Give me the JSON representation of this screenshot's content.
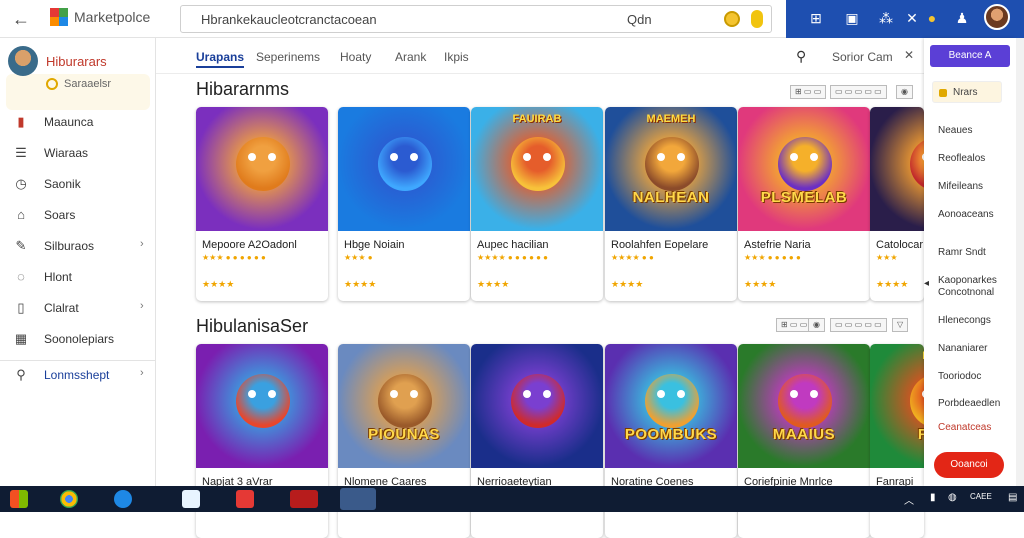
{
  "app": {
    "logo_text": "Marketpolce",
    "search_query": "Hbrankekaucleotcranctacoean",
    "search_hint": "Qdn"
  },
  "colors": {
    "accent": "#1a3f9a",
    "topbar_blue": "#1e4fb0",
    "primary_button": "#5b3fd6",
    "danger": "#e32616"
  },
  "sidebar": {
    "profile": {
      "name": "Hiburarars",
      "sub": "Saraaelsr"
    },
    "items": [
      {
        "label": "Maaunca",
        "icon": "home-icon",
        "chevron": ""
      },
      {
        "label": "Wiaraas",
        "icon": "list-icon",
        "chevron": ""
      },
      {
        "label": "Saonik",
        "icon": "clock-icon",
        "chevron": ""
      },
      {
        "label": "Soars",
        "icon": "bookmark-icon",
        "chevron": ""
      },
      {
        "label": "Silburaos",
        "icon": "tag-icon",
        "chevron": "›"
      },
      {
        "label": "Hlont",
        "icon": "chat-icon",
        "chevron": ""
      },
      {
        "label": "Clalrat",
        "icon": "document-icon",
        "chevron": "›"
      },
      {
        "label": "Soonolepiars",
        "icon": "grid-icon",
        "chevron": ""
      },
      {
        "label": "Lonmsshept",
        "icon": "search-icon",
        "chevron": "›"
      }
    ]
  },
  "tabs": {
    "items": [
      "Urapans",
      "Seperinems",
      "Hoaty",
      "Arank",
      "Ikpis"
    ],
    "sort_label": "Sorior Cam",
    "close_glyph": "✕"
  },
  "sections": [
    {
      "title": "Hibararnms",
      "controls": [
        "⊞ ▭ ▭",
        "▭ ▭ ▭ ▭ ▭",
        "◉"
      ],
      "cards": [
        {
          "title": "Mepoore A2Oadonl",
          "meta": "★★★  ● ● ● ● ● ●",
          "stars": "★★★★"
        },
        {
          "title": "Hbge Noiain",
          "meta": "★★★  ●",
          "stars": "★★★★"
        },
        {
          "title": "Aupec hacilian",
          "meta": "★★★★  ● ● ● ● ● ●",
          "stars": "★★★★"
        },
        {
          "title": "Roolahfen Eopelare",
          "meta": "★★★★  ● ●",
          "stars": "★★★★"
        },
        {
          "title": "Astefrie Naria",
          "meta": "★★★  ● ● ● ● ●",
          "stars": "★★★★"
        },
        {
          "title": "Catolocar",
          "meta": "★★★",
          "stars": "★★★★"
        }
      ]
    },
    {
      "title": "HibulanisaSer",
      "controls": [
        "⊞ ▭ ▭",
        "◉",
        "▭ ▭ ▭ ▭ ▭",
        "▽"
      ],
      "cards": [
        {
          "title": "Napjat 3 aVrar",
          "meta": "",
          "stars": ""
        },
        {
          "title": "Nlomene Caares",
          "meta": "",
          "stars": ""
        },
        {
          "title": "Nerrioaeteytian",
          "meta": "★★",
          "stars": ""
        },
        {
          "title": "Noratine Coenes",
          "meta": "",
          "stars": ""
        },
        {
          "title": "Coriefpinie Mnrlce",
          "meta": "",
          "stars": ""
        },
        {
          "title": "Fanrapi",
          "meta": "",
          "stars": ""
        }
      ]
    }
  ],
  "card_art": [
    {
      "banner": "",
      "top": ""
    },
    {
      "banner": "",
      "top": ""
    },
    {
      "banner": "",
      "top": "FAUIRAB"
    },
    {
      "banner": "NALHEAN",
      "top": "MAEMEH"
    },
    {
      "banner": "PLSMELAB",
      "top": ""
    },
    {
      "banner": "",
      "top": ""
    },
    {
      "banner": "",
      "top": ""
    },
    {
      "banner": "PIOUNAS",
      "top": ""
    },
    {
      "banner": "",
      "top": ""
    },
    {
      "banner": "POOMBUKS",
      "top": ""
    },
    {
      "banner": "MAAIUS",
      "top": ""
    },
    {
      "banner": "FAUI",
      "top": "BOIB"
    }
  ],
  "right_panel": {
    "primary_button": "Beance A",
    "chip": "Nrars",
    "items": [
      "Neaues",
      "Reoflealos",
      "Mifeileans",
      "Aonoaceans",
      "Ramr Sndt",
      "Kaoponarkes Concotnonal",
      "Hlenecongs",
      "Nananiarer",
      "Tooriodoc",
      "Porbdeaedlen",
      "Ceanatceas"
    ],
    "danger_button": "Ooancoi"
  },
  "taskbar": {
    "tray_text": "CAEE"
  }
}
